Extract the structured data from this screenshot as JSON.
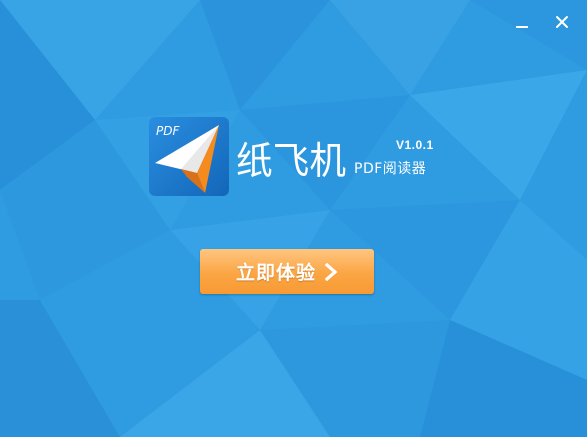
{
  "titlebar": {
    "minimize_icon": "minimize-icon",
    "close_icon": "close-icon"
  },
  "app": {
    "logo_badge": "PDF",
    "name": "纸飞机",
    "version": "V1.0.1",
    "subtitle": "PDF阅读器"
  },
  "actions": {
    "start_label": "立即体验",
    "start_icon": "chevron-right-icon"
  },
  "colors": {
    "background": "#2f9be0",
    "button_top": "#ffc680",
    "button_bottom": "#f79a33",
    "logo_blue": "#1d7fd1",
    "plane_orange": "#f58a1f"
  }
}
